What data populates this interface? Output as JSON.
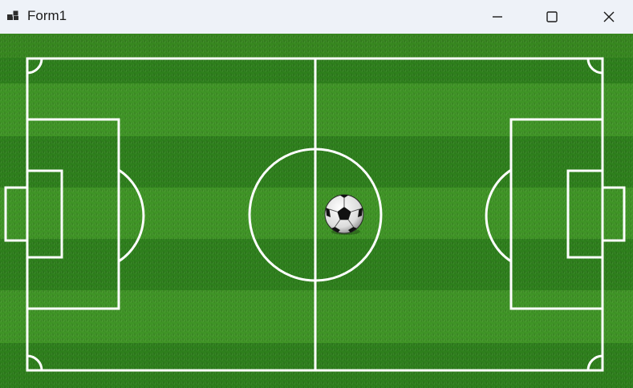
{
  "window": {
    "title": "Form1",
    "app_icon": "form-app-icon",
    "controls": {
      "minimize_icon": "minimize-icon",
      "maximize_icon": "maximize-icon",
      "close_icon": "close-icon"
    }
  },
  "colors": {
    "titlebar": "#eef2f8",
    "grass_light": "#3f9426",
    "grass_dark": "#2e7f1c",
    "lines": "#ffffff"
  },
  "ball": {
    "icon": "soccer-ball-icon"
  }
}
